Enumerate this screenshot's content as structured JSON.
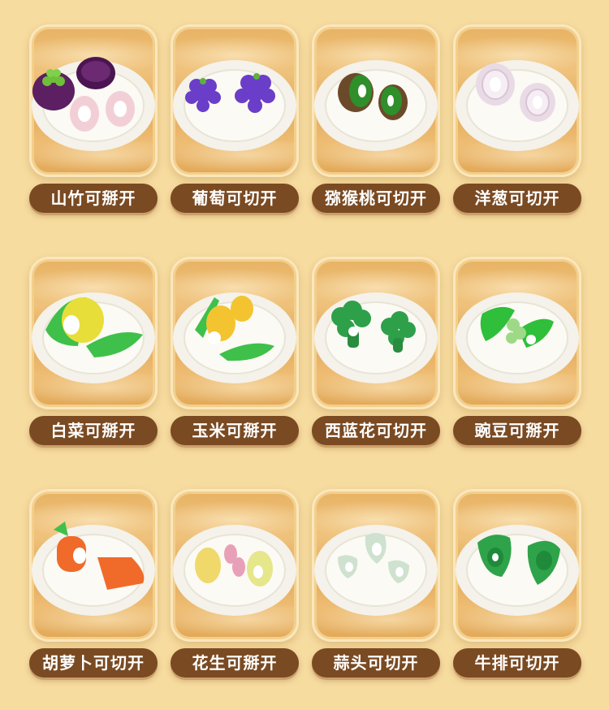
{
  "items": [
    {
      "label": "山竹可掰开"
    },
    {
      "label": "葡萄可切开"
    },
    {
      "label": "猕猴桃可切开"
    },
    {
      "label": "洋葱可切开"
    },
    {
      "label": "白菜可掰开"
    },
    {
      "label": "玉米可掰开"
    },
    {
      "label": "西蓝花可切开"
    },
    {
      "label": "豌豆可掰开"
    },
    {
      "label": "胡萝卜可切开"
    },
    {
      "label": "花生可掰开"
    },
    {
      "label": "蒜头可切开"
    },
    {
      "label": "牛排可切开"
    }
  ],
  "colors": {
    "background": "#f7dca0",
    "label_bg": "#7a4a22",
    "label_text": "#ffffff"
  }
}
